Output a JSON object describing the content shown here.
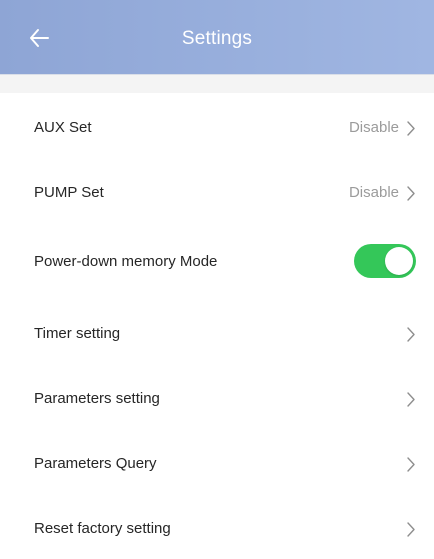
{
  "header": {
    "title": "Settings",
    "back_icon": "arrow-left-icon",
    "background": "#97AEDC"
  },
  "settings": {
    "aux": {
      "label": "AUX Set",
      "value": "Disable"
    },
    "pump": {
      "label": "PUMP Set",
      "value": "Disable"
    },
    "power_memory": {
      "label": "Power-down memory Mode",
      "enabled": true,
      "toggle_color": "#34C759"
    },
    "timer": {
      "label": "Timer setting"
    },
    "parameters": {
      "label": "Parameters setting"
    },
    "query": {
      "label": "Parameters Query"
    },
    "reset": {
      "label": "Reset factory setting"
    }
  },
  "icons": {
    "chevron": "chevron-right-icon"
  }
}
